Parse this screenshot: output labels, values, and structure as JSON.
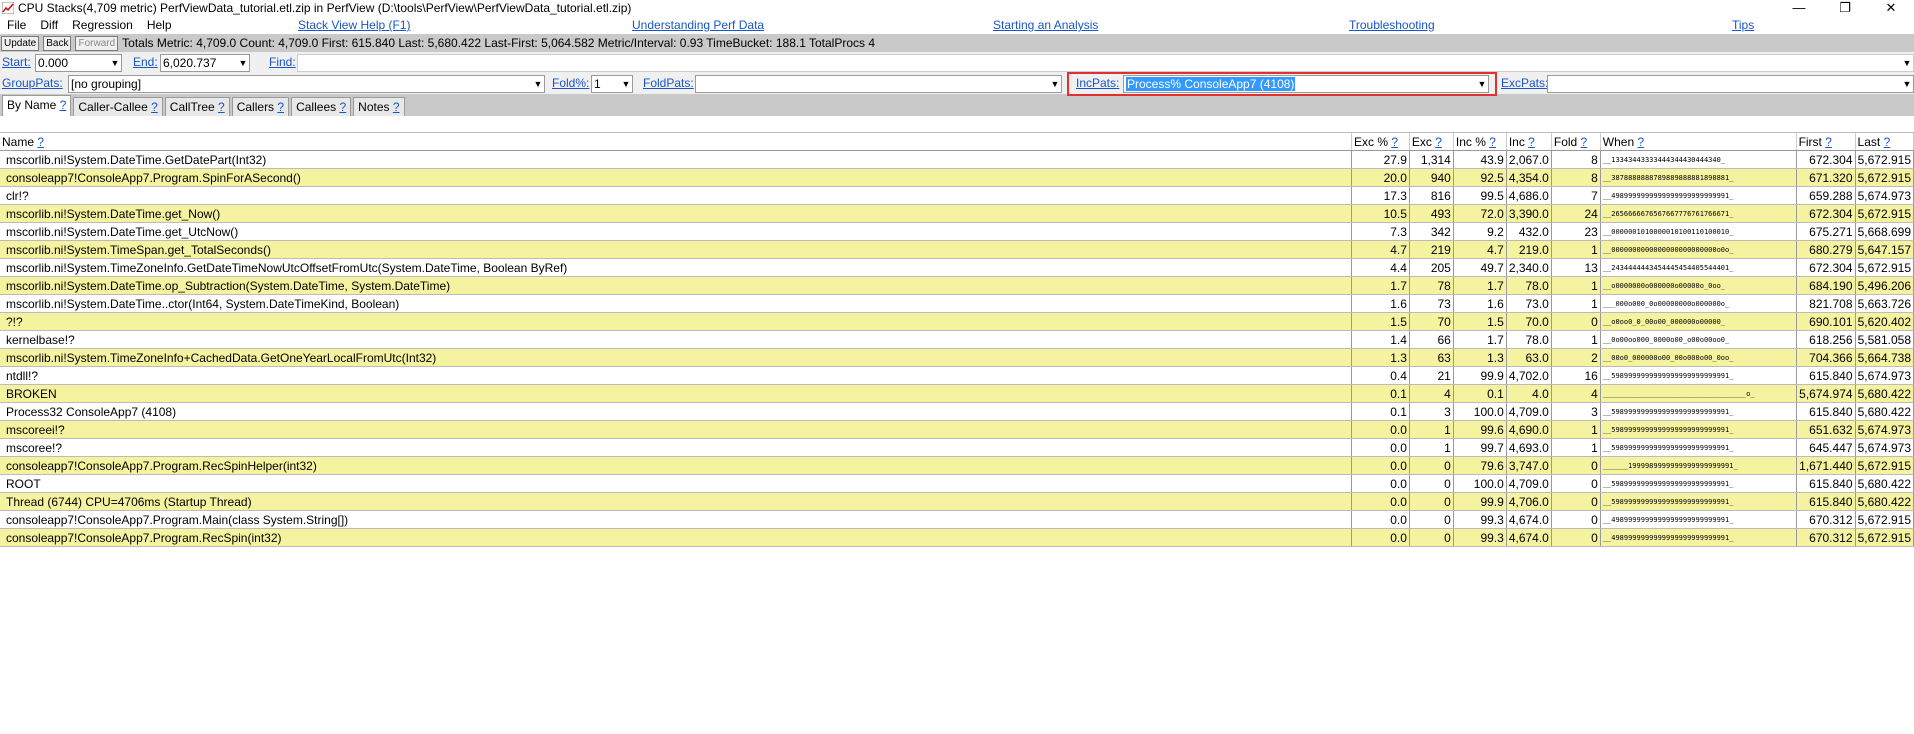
{
  "window": {
    "title": "CPU Stacks(4,709 metric) PerfViewData_tutorial.etl.zip in PerfView (D:\\tools\\PerfView\\PerfViewData_tutorial.etl.zip)",
    "min": "—",
    "max": "❐",
    "close": "✕"
  },
  "menu": {
    "file": "File",
    "diff": "Diff",
    "regression": "Regression",
    "help": "Help",
    "links": {
      "stackview": "Stack View Help (F1)",
      "perfdata": "Understanding Perf Data",
      "starting": "Starting an Analysis",
      "troubleshooting": "Troubleshooting",
      "tips": "Tips"
    }
  },
  "status": {
    "update": "Update",
    "back": "Back",
    "forward": "Forward",
    "text": "Totals Metric: 4,709.0  Count: 4,709.0  First: 615.840  Last: 5,680.422  Last-First: 5,064.582  Metric/Interval: 0.93  TimeBucket: 188.1  TotalProcs 4"
  },
  "filters": {
    "start_label": "Start:",
    "start_value": "0.000",
    "end_label": "End:",
    "end_value": "6,020.737",
    "find_label": "Find:",
    "find_value": "",
    "grouppats_label": "GroupPats:",
    "grouppats_value": "[no grouping]",
    "fold_label": "Fold%:",
    "fold_value": "1",
    "foldpats_label": "FoldPats:",
    "foldpats_value": "",
    "incpats_label": "IncPats:",
    "incpats_value": "Process% ConsoleApp7 (4108)",
    "excpats_label": "ExcPats:",
    "excpats_value": ""
  },
  "tabs": [
    {
      "label": "By Name",
      "active": true
    },
    {
      "label": "Caller-Callee"
    },
    {
      "label": "CallTree"
    },
    {
      "label": "Callers"
    },
    {
      "label": "Callees"
    },
    {
      "label": "Notes"
    }
  ],
  "table": {
    "headers": {
      "name": "Name",
      "exc_pct": "Exc %",
      "exc": "Exc",
      "inc_pct": "Inc %",
      "inc": "Inc",
      "fold": "Fold",
      "when": "When",
      "first": "First",
      "last": "Last",
      "q": "?"
    },
    "rows": [
      [
        "mscorlib.ni!System.DateTime.GetDatePart(Int32)",
        "27.9",
        "1,314",
        "43.9",
        "2,067.0",
        "8",
        "__13343443333444344430444340_",
        "672.304",
        "5,672.915"
      ],
      [
        "consoleapp7!ConsoleApp7.Program.SpinForASecond()",
        "20.0",
        "940",
        "92.5",
        "4,354.0",
        "8",
        "__3878888888789889888881898881_",
        "671.320",
        "5,672.915"
      ],
      [
        "clr!?",
        "17.3",
        "816",
        "99.5",
        "4,686.0",
        "7",
        "__4989999999999999999999999991_",
        "659.288",
        "5,674.973"
      ],
      [
        "mscorlib.ni!System.DateTime.get_Now()",
        "10.5",
        "493",
        "72.0",
        "3,390.0",
        "24",
        "__2656666676567667776761766671_",
        "672.304",
        "5,672.915"
      ],
      [
        "mscorlib.ni!System.DateTime.get_UtcNow()",
        "7.3",
        "342",
        "9.2",
        "432.0",
        "23",
        "__0000001010000010100110100010_",
        "675.271",
        "5,668.699"
      ],
      [
        "mscorlib.ni!System.TimeSpan.get_TotalSeconds()",
        "4.7",
        "219",
        "4.7",
        "219.0",
        "1",
        "__0000000000000000000000000o0o_",
        "680.279",
        "5,647.157"
      ],
      [
        "mscorlib.ni!System.TimeZoneInfo.GetDateTimeNowUtcOffsetFromUtc(System.DateTime, Boolean ByRef)",
        "4.4",
        "205",
        "49.7",
        "2,340.0",
        "13",
        "__2434444443454445454405544401_",
        "672.304",
        "5,672.915"
      ],
      [
        "mscorlib.ni!System.DateTime.op_Subtraction(System.DateTime, System.DateTime)",
        "1.7",
        "78",
        "1.7",
        "78.0",
        "1",
        "__o0000000o000000o00000o_0oo_",
        "684.190",
        "5,496.206"
      ],
      [
        "mscorlib.ni!System.DateTime..ctor(Int64, System.DateTimeKind, Boolean)",
        "1.6",
        "73",
        "1.6",
        "73.0",
        "1",
        "___000o000_0o00000000o000000o_",
        "821.708",
        "5,663.726"
      ],
      [
        "?!?",
        "1.5",
        "70",
        "1.5",
        "70.0",
        "0",
        "__o0oo0_0_00o00_000000o00000_",
        "690.101",
        "5,620.402"
      ],
      [
        "kernelbase!?",
        "1.4",
        "66",
        "1.7",
        "78.0",
        "1",
        "__0o00oo000_0000o00_o00o00oo0_",
        "618.256",
        "5,581.058"
      ],
      [
        "mscorlib.ni!System.TimeZoneInfo+CachedData.GetOneYearLocalFromUtc(Int32)",
        "1.3",
        "63",
        "1.3",
        "63.0",
        "2",
        "__00o0_000000o00_00o000o00_0oo_",
        "704.366",
        "5,664.738"
      ],
      [
        "ntdll!?",
        "0.4",
        "21",
        "99.9",
        "4,702.0",
        "16",
        "__5989999999999999999999999991_",
        "615.840",
        "5,674.973"
      ],
      [
        "BROKEN",
        "0.1",
        "4",
        "0.1",
        "4.0",
        "4",
        "__________________________________o_",
        "5,674.974",
        "5,680.422"
      ],
      [
        "Process32 ConsoleApp7 (4108)",
        "0.1",
        "3",
        "100.0",
        "4,709.0",
        "3",
        "__5989999999999999999999999991_",
        "615.840",
        "5,680.422"
      ],
      [
        "mscoreei!?",
        "0.0",
        "1",
        "99.6",
        "4,690.0",
        "1",
        "__5989999999999999999999999991_",
        "651.632",
        "5,674.973"
      ],
      [
        "mscoree!?",
        "0.0",
        "1",
        "99.7",
        "4,693.0",
        "1",
        "__5989999999999999999999999991_",
        "645.447",
        "5,674.973"
      ],
      [
        "consoleapp7!ConsoleApp7.Program.RecSpinHelper(int32)",
        "0.0",
        "0",
        "79.6",
        "3,747.0",
        "0",
        "______1999989999999999999999991_",
        "1,671.440",
        "5,672.915"
      ],
      [
        "ROOT",
        "0.0",
        "0",
        "100.0",
        "4,709.0",
        "0",
        "__5989999999999999999999999991_",
        "615.840",
        "5,680.422"
      ],
      [
        "Thread (6744) CPU=4706ms (Startup Thread)",
        "0.0",
        "0",
        "99.9",
        "4,706.0",
        "0",
        "__5989999999999999999999999991_",
        "615.840",
        "5,680.422"
      ],
      [
        "consoleapp7!ConsoleApp7.Program.Main(class System.String[])",
        "0.0",
        "0",
        "99.3",
        "4,674.0",
        "0",
        "__4989999999999999999999999991_",
        "670.312",
        "5,672.915"
      ],
      [
        "consoleapp7!ConsoleApp7.Program.RecSpin(int32)",
        "0.0",
        "0",
        "99.3",
        "4,674.0",
        "0",
        "__4989999999999999999999999991_",
        "670.312",
        "5,672.915"
      ]
    ]
  },
  "colors": {
    "alt_row": "#f5f2a0",
    "link": "#1a55c7",
    "highlight_box": "#e03030",
    "selection": "#3399ff"
  }
}
